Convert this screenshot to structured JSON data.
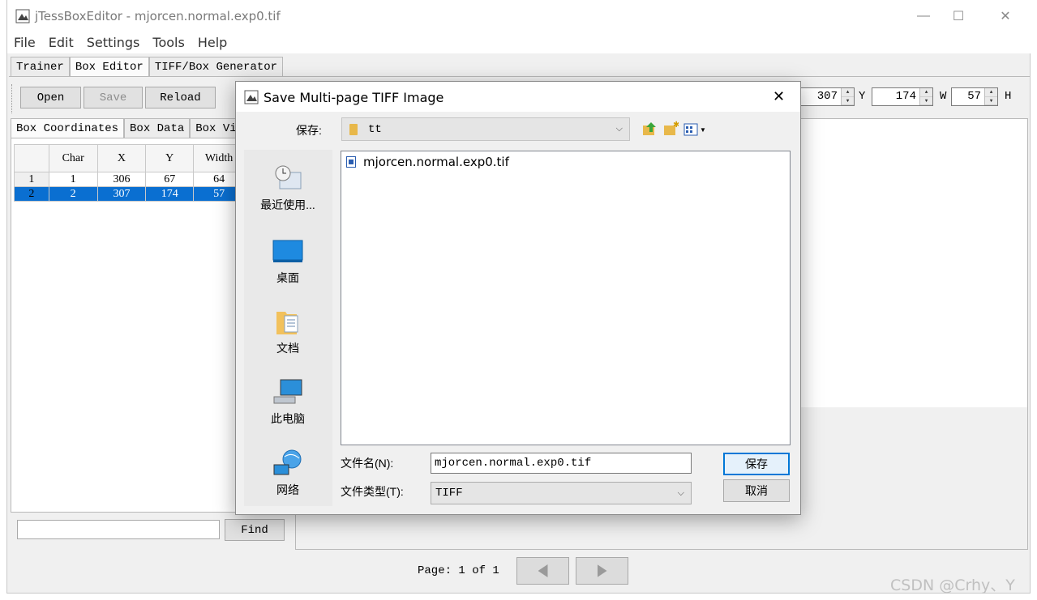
{
  "window": {
    "title": "jTessBoxEditor - mjorcen.normal.exp0.tif"
  },
  "menu": [
    "File",
    "Edit",
    "Settings",
    "Tools",
    "Help"
  ],
  "tabs": [
    "Trainer",
    "Box Editor",
    "TIFF/Box Generator"
  ],
  "toolbar": {
    "open": "Open",
    "save": "Save",
    "reload": "Reload",
    "x_value": "307",
    "y_label": "Y",
    "y_value": "174",
    "w_label": "W",
    "w_value": "57",
    "h_label": "H"
  },
  "subtabs": [
    "Box Coordinates",
    "Box Data",
    "Box Vie"
  ],
  "table": {
    "headers": [
      "",
      "Char",
      "X",
      "Y",
      "Width"
    ],
    "rows": [
      [
        "1",
        "1",
        "306",
        "67",
        "64"
      ],
      [
        "2",
        "2",
        "307",
        "174",
        "57"
      ]
    ]
  },
  "find": {
    "button": "Find",
    "value": ""
  },
  "page": {
    "label": "Page:  1  of  1"
  },
  "dialog": {
    "title": "Save Multi-page TIFF Image",
    "save_in_label": "保存:",
    "save_in_value": "tt",
    "places": [
      "最近使用...",
      "桌面",
      "文档",
      "此电脑",
      "网络"
    ],
    "files": [
      "mjorcen.normal.exp0.tif"
    ],
    "filename_label": "文件名(N):",
    "filename_value": "mjorcen.normal.exp0.tif",
    "filetype_label": "文件类型(T):",
    "filetype_value": "TIFF",
    "save_button": "保存",
    "cancel_button": "取消"
  },
  "watermark": "CSDN @Crhy、Y",
  "colors": {
    "selection": "#0a6fd1",
    "dialog_bg": "#f0f0f0",
    "primary_border": "#0078d7"
  }
}
